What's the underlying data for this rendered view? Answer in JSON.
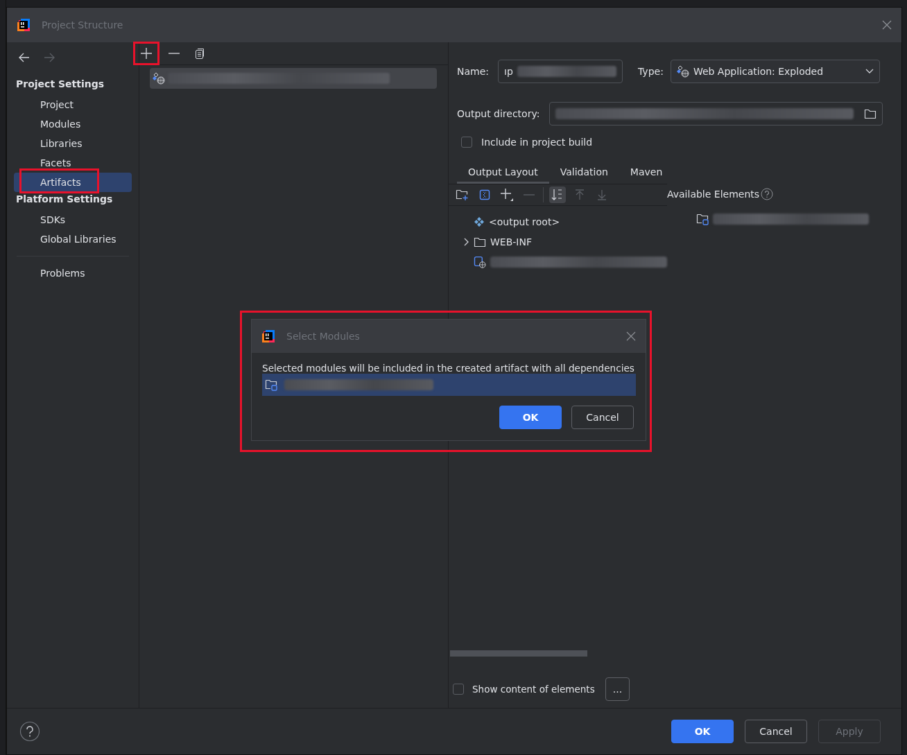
{
  "window": {
    "title": "Project Structure"
  },
  "nav": {
    "back_enabled": true,
    "forward_enabled": false
  },
  "sidebar": {
    "sections": [
      {
        "heading": "Project Settings",
        "items": [
          {
            "label": "Project",
            "selected": false,
            "highlighted": false
          },
          {
            "label": "Modules",
            "selected": false,
            "highlighted": false
          },
          {
            "label": "Libraries",
            "selected": false,
            "highlighted": false
          },
          {
            "label": "Facets",
            "selected": false,
            "highlighted": false
          },
          {
            "label": "Artifacts",
            "selected": true,
            "highlighted": true
          }
        ]
      },
      {
        "heading": "Platform Settings",
        "items": [
          {
            "label": "SDKs",
            "selected": false,
            "highlighted": false
          },
          {
            "label": "Global Libraries",
            "selected": false,
            "highlighted": false
          }
        ]
      },
      {
        "items": [
          {
            "label": "Problems",
            "selected": false,
            "highlighted": false
          }
        ]
      }
    ]
  },
  "artifact_toolbar": {
    "add_highlighted": true
  },
  "artifact_list": [
    {
      "selected": true
    }
  ],
  "editor": {
    "name_label": "Name:",
    "name_value": "ıp",
    "type_label": "Type:",
    "type_value": "Web Application: Exploded",
    "output_label": "Output directory:",
    "include_label": "Include in project build",
    "include_checked": false,
    "tabs": [
      {
        "label": "Output Layout",
        "selected": true
      },
      {
        "label": "Validation",
        "selected": false
      },
      {
        "label": "Maven",
        "selected": false
      }
    ],
    "layout_tree": [
      {
        "kind": "root",
        "label": "<output root>"
      },
      {
        "kind": "folder",
        "label": "WEB-INF",
        "expanded": false
      },
      {
        "kind": "module"
      }
    ],
    "available_label": "Available Elements",
    "show_content_label": "Show content of elements",
    "show_content_checked": false,
    "browse_label": "..."
  },
  "dialog": {
    "title": "Select Modules",
    "message": "Selected modules will be included in the created artifact with all dependencies",
    "modules": [
      {
        "selected": true
      }
    ],
    "highlighted": true,
    "buttons": [
      {
        "label": "OK",
        "kind": "primary"
      },
      {
        "label": "Cancel",
        "kind": "secondary"
      }
    ]
  },
  "footer": {
    "buttons": [
      {
        "label": "OK",
        "kind": "primary"
      },
      {
        "label": "Cancel",
        "kind": "secondary"
      },
      {
        "label": "Apply",
        "kind": "disabled"
      }
    ]
  }
}
